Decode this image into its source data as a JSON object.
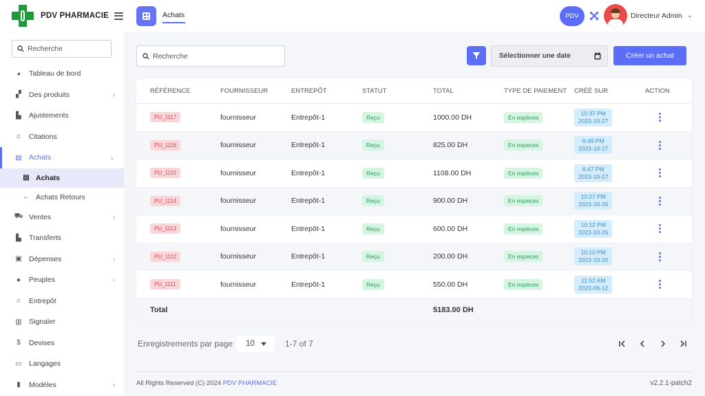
{
  "brand": {
    "name": "PDV PHARMACIE"
  },
  "sidebar": {
    "search_placeholder": "Recherche",
    "items": [
      {
        "label": "Tableau de bord",
        "icon": "dashboard-icon",
        "chevron": false
      },
      {
        "label": "Des produits",
        "icon": "boxes-icon",
        "chevron": true
      },
      {
        "label": "Ajustements",
        "icon": "adjust-icon",
        "chevron": false
      },
      {
        "label": "Citations",
        "icon": "basket-icon",
        "chevron": false
      },
      {
        "label": "Achats",
        "icon": "receipt-icon",
        "chevron": true,
        "open": true
      },
      {
        "label": "Ventes",
        "icon": "cart-icon",
        "chevron": true
      },
      {
        "label": "Transferts",
        "icon": "transfer-icon",
        "chevron": false
      },
      {
        "label": "Dépenses",
        "icon": "money-icon",
        "chevron": true
      },
      {
        "label": "Peuples",
        "icon": "user-icon",
        "chevron": true
      },
      {
        "label": "Entrepôt",
        "icon": "home-icon",
        "chevron": false
      },
      {
        "label": "Signaler",
        "icon": "chart-icon",
        "chevron": false
      },
      {
        "label": "Devises",
        "icon": "dollar-icon",
        "chevron": false
      },
      {
        "label": "Langages",
        "icon": "language-icon",
        "chevron": false
      },
      {
        "label": "Modèles",
        "icon": "file-icon",
        "chevron": true
      }
    ],
    "sub_items": [
      {
        "label": "Achats",
        "active": true
      },
      {
        "label": "Achats Retours",
        "active": false
      }
    ]
  },
  "header": {
    "breadcrumb": "Achats",
    "pdv_label": "PDV",
    "user_name": "Directeur Admin"
  },
  "toolbar": {
    "search_placeholder": "Recherche",
    "date_label": "Sélectionner une date",
    "create_label": "Créer un achat"
  },
  "table": {
    "columns": [
      "RÉFÉRENCE",
      "FOURNISSEUR",
      "ENTREPÔT",
      "STATUT",
      "TOTAL",
      "TYPE DE PAIEMENT",
      "CRÉÉ SUR",
      "ACTION"
    ],
    "rows": [
      {
        "ref": "PU_1117",
        "supplier": "fournisseur",
        "warehouse": "Entrepôt-1",
        "status": "Reçu",
        "total": "1000.00 DH",
        "payment": "En espèces",
        "time": "10:37 PM",
        "date": "2023-10-27"
      },
      {
        "ref": "PU_1116",
        "supplier": "fournisseur",
        "warehouse": "Entrepôt-1",
        "status": "Reçu",
        "total": "825.00 DH",
        "payment": "En espèces",
        "time": "6:49 PM",
        "date": "2023-10-27"
      },
      {
        "ref": "PU_1115",
        "supplier": "fournisseur",
        "warehouse": "Entrepôt-1",
        "status": "Reçu",
        "total": "1108.00 DH",
        "payment": "En espèces",
        "time": "6:47 PM",
        "date": "2023-10-27"
      },
      {
        "ref": "PU_1114",
        "supplier": "fournisseur",
        "warehouse": "Entrepôt-1",
        "status": "Reçu",
        "total": "900.00 DH",
        "payment": "En espèces",
        "time": "10:27 PM",
        "date": "2023-10-26"
      },
      {
        "ref": "PU_1113",
        "supplier": "fournisseur",
        "warehouse": "Entrepôt-1",
        "status": "Reçu",
        "total": "600.00 DH",
        "payment": "En espèces",
        "time": "10:12 PM",
        "date": "2023-10-26"
      },
      {
        "ref": "PU_1112",
        "supplier": "fournisseur",
        "warehouse": "Entrepôt-1",
        "status": "Reçu",
        "total": "200.00 DH",
        "payment": "En espèces",
        "time": "10:10 PM",
        "date": "2023-10-26"
      },
      {
        "ref": "PU_1111",
        "supplier": "fournisseur",
        "warehouse": "Entrepôt-1",
        "status": "Reçu",
        "total": "550.00 DH",
        "payment": "En espèces",
        "time": "11:52 AM",
        "date": "2023-06-12"
      }
    ],
    "footer_label": "Total",
    "footer_total": "5183.00 DH"
  },
  "pagination": {
    "per_page_label": "Enregistrements par page",
    "per_page_value": "10",
    "range": "1-7 of 7",
    "first": "|<",
    "prev": "<",
    "next": ">",
    "last": ">|"
  },
  "footer": {
    "copyright": "All Rights Reserved (C) 2024",
    "brand": "PDV PHARMACIE",
    "version": "v2.2.1-patch2"
  },
  "colors": {
    "accent": "#5b6ef5",
    "logo_green": "#1f9a3a",
    "ref_badge_bg": "#fbd6d9",
    "status_badge_bg": "#d5f5e3",
    "date_badge_bg": "#d4ecfb"
  }
}
